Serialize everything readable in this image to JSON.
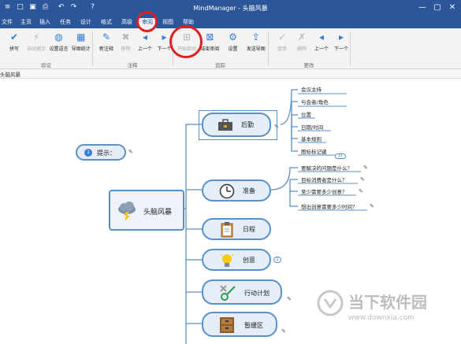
{
  "window": {
    "title": "MindManager - 头脑风暴",
    "quick_access": [
      {
        "name": "app-menu-icon",
        "glyph": "≡"
      },
      {
        "name": "new-icon",
        "glyph": "□"
      },
      {
        "name": "save-icon",
        "glyph": "▣"
      },
      {
        "name": "print-icon",
        "glyph": "⎙"
      },
      {
        "name": "undo-icon",
        "glyph": "↶"
      },
      {
        "name": "redo-icon",
        "glyph": "↷"
      },
      {
        "name": "help-icon",
        "glyph": "?"
      }
    ],
    "controls": {
      "restore": "▢",
      "close": "✕",
      "minimize": "—"
    }
  },
  "ribbon": {
    "tabs": [
      "文件",
      "主页",
      "插入",
      "任务",
      "设计",
      "格式",
      "高级",
      "审阅",
      "视图",
      "帮助"
    ],
    "active_tab": "审阅",
    "groups": [
      {
        "label": "验证",
        "buttons": [
          {
            "label": "拼写",
            "icon": "spellcheck-icon",
            "glyph": "✔",
            "color": "#3a7bd5",
            "disabled": false
          },
          {
            "label": "自动更正",
            "icon": "autocorrect-icon",
            "glyph": "⚡",
            "color": "#d59b2a",
            "disabled": true
          },
          {
            "label": "设置语言",
            "icon": "language-icon",
            "glyph": "◍",
            "color": "#3a7bd5",
            "disabled": false
          },
          {
            "label": "导图统计",
            "icon": "statistics-icon",
            "glyph": "▦",
            "color": "#3a7bd5",
            "disabled": false
          }
        ]
      },
      {
        "label": "注释",
        "buttons": [
          {
            "label": "新注释",
            "icon": "new-comment-icon",
            "glyph": "✎",
            "color": "#3a7bd5",
            "disabled": false
          },
          {
            "label": "移除",
            "icon": "remove-comment-icon",
            "glyph": "✖",
            "color": "#999",
            "disabled": true
          },
          {
            "label": "上一个",
            "icon": "previous-comment-icon",
            "glyph": "◂",
            "color": "#3a7bd5",
            "disabled": false
          },
          {
            "label": "下一个",
            "icon": "next-comment-icon",
            "glyph": "▸",
            "color": "#3a7bd5",
            "disabled": false
          }
        ]
      },
      {
        "label": "追踪",
        "buttons": [
          {
            "label": "开始审阅",
            "icon": "start-review-icon",
            "glyph": "⊞",
            "color": "#3a7bd5",
            "disabled": true
          },
          {
            "label": "结束审阅",
            "icon": "end-review-icon",
            "glyph": "⊠",
            "color": "#3a7bd5",
            "disabled": false
          },
          {
            "label": "设置",
            "icon": "settings-icon",
            "glyph": "⚙",
            "color": "#3a7bd5",
            "disabled": false
          },
          {
            "label": "发送导图",
            "icon": "send-map-icon",
            "glyph": "⇪",
            "color": "#3a7bd5",
            "disabled": false
          }
        ]
      },
      {
        "label": "更改",
        "buttons": [
          {
            "label": "接受",
            "icon": "accept-icon",
            "glyph": "✓",
            "color": "#999",
            "disabled": true
          },
          {
            "label": "删除",
            "icon": "reject-icon",
            "glyph": "✗",
            "color": "#999",
            "disabled": true
          },
          {
            "label": "上一个",
            "icon": "previous-change-icon",
            "glyph": "◂",
            "color": "#3a7bd5",
            "disabled": false
          },
          {
            "label": "下一个",
            "icon": "next-change-icon",
            "glyph": "▸",
            "color": "#3a7bd5",
            "disabled": false
          }
        ]
      }
    ]
  },
  "document_tab": "头脑风暴",
  "mindmap": {
    "central": {
      "label": "头脑风暴",
      "icon": "storm-cloud-icon"
    },
    "callout": {
      "label": "提示：",
      "badge": "1"
    },
    "branches": [
      {
        "label": "后勤",
        "icon": "toolbox-icon",
        "children": [
          "会议主持",
          "与会者/角色",
          "位置",
          "日期/时间",
          "基本规则",
          "图标标记键"
        ],
        "badge": "11"
      },
      {
        "label": "准备",
        "icon": "clock-icon",
        "children": [
          "要解决的问题是什么？",
          "目标消费者是什么？",
          "至少需要多少创意？",
          "想出创意需要多少时间？"
        ]
      },
      {
        "label": "日程",
        "icon": "clipboard-icon",
        "children": []
      },
      {
        "label": "创意",
        "icon": "lightbulb-icon",
        "children": [],
        "badge": "1"
      },
      {
        "label": "行动计划",
        "icon": "tic-tac-toe-icon",
        "children": []
      },
      {
        "label": "暂缓区",
        "icon": "cabinet-icon",
        "children": []
      }
    ]
  },
  "watermark": {
    "name": "当下软件园",
    "url": "www.downxia.com"
  },
  "colors": {
    "titlebar": "#2b579a",
    "highlight_ring": "#e02020",
    "topic_border": "#5b8fc7",
    "topic_fill": "#e5eef8",
    "connector": "#5b8fc7"
  }
}
